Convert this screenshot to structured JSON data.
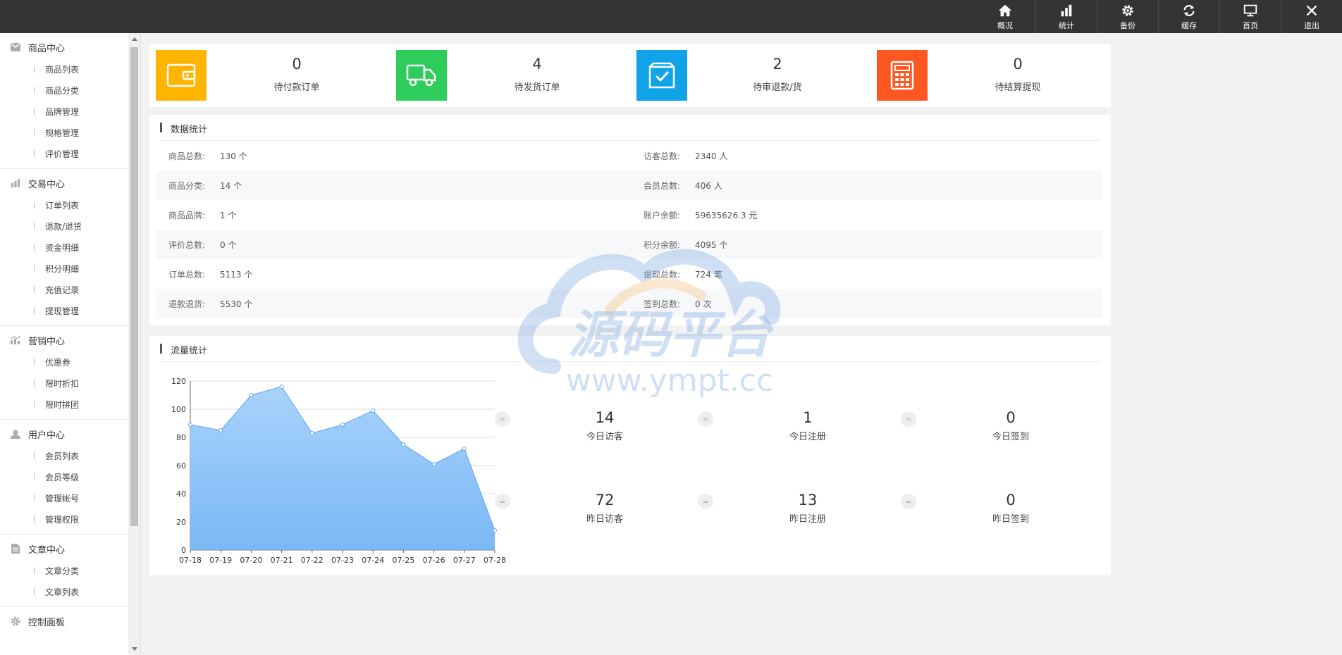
{
  "topnav": [
    {
      "label": "概况",
      "icon": "home-icon"
    },
    {
      "label": "统计",
      "icon": "bar-chart-icon"
    },
    {
      "label": "备份",
      "icon": "gear-icon"
    },
    {
      "label": "缓存",
      "icon": "refresh-icon"
    },
    {
      "label": "首页",
      "icon": "monitor-icon"
    },
    {
      "label": "退出",
      "icon": "close-icon"
    }
  ],
  "sidebar": {
    "groups": [
      {
        "title": "商品中心",
        "icon": "mail-icon",
        "items": [
          "商品列表",
          "商品分类",
          "品牌管理",
          "规格管理",
          "评价管理"
        ]
      },
      {
        "title": "交易中心",
        "icon": "bar-chart-icon",
        "items": [
          "订单列表",
          "退款/退货",
          "资金明细",
          "积分明细",
          "充值记录",
          "提现管理"
        ]
      },
      {
        "title": "营销中心",
        "icon": "marketing-chart-icon",
        "items": [
          "优惠券",
          "限时折扣",
          "限时拼团"
        ]
      },
      {
        "title": "用户中心",
        "icon": "user-icon",
        "items": [
          "会员列表",
          "会员等级",
          "管理帐号",
          "管理权限"
        ]
      },
      {
        "title": "文章中心",
        "icon": "document-icon",
        "items": [
          "文章分类",
          "文章列表"
        ]
      },
      {
        "title": "控制面板",
        "icon": "gear-icon",
        "items": []
      }
    ]
  },
  "cards": [
    {
      "value": "0",
      "label": "待付款订单",
      "color": "#ffb400",
      "icon": "wallet-icon"
    },
    {
      "value": "4",
      "label": "待发货订单",
      "color": "#2ecc5a",
      "icon": "truck-icon"
    },
    {
      "value": "2",
      "label": "待审退款/货",
      "color": "#10a3e8",
      "icon": "box-check-icon"
    },
    {
      "value": "0",
      "label": "待结算提现",
      "color": "#ff5722",
      "icon": "calculator-icon"
    }
  ],
  "data_stats": {
    "title": "数据统计",
    "rows": [
      {
        "k1": "商品总数:",
        "v1": "130 个",
        "k2": "访客总数:",
        "v2": "2340 人"
      },
      {
        "k1": "商品分类:",
        "v1": "14 个",
        "k2": "会员总数:",
        "v2": "406 人"
      },
      {
        "k1": "商品品牌:",
        "v1": "1 个",
        "k2": "账户余额:",
        "v2": "59635626.3 元"
      },
      {
        "k1": "评价总数:",
        "v1": "0 个",
        "k2": "积分余额:",
        "v2": "4095 个"
      },
      {
        "k1": "订单总数:",
        "v1": "5113 个",
        "k2": "提现总数:",
        "v2": "724 笔"
      },
      {
        "k1": "退款退货:",
        "v1": "5530 个",
        "k2": "签到总数:",
        "v2": "0 次"
      }
    ]
  },
  "traffic": {
    "title": "流量统计",
    "eq_symbol": "=",
    "stats": [
      {
        "value": "14",
        "label": "今日访客"
      },
      {
        "value": "1",
        "label": "今日注册"
      },
      {
        "value": "0",
        "label": "今日签到"
      },
      {
        "value": "72",
        "label": "昨日访客"
      },
      {
        "value": "13",
        "label": "昨日注册"
      },
      {
        "value": "0",
        "label": "昨日签到"
      }
    ]
  },
  "chart_data": {
    "type": "area",
    "categories": [
      "07-18",
      "07-19",
      "07-20",
      "07-21",
      "07-22",
      "07-23",
      "07-24",
      "07-25",
      "07-26",
      "07-27",
      "07-28"
    ],
    "values": [
      89,
      85,
      110,
      116,
      83,
      89,
      99,
      75,
      61,
      72,
      14
    ],
    "ylim": [
      0,
      120
    ],
    "yticks": [
      0,
      20,
      40,
      60,
      80,
      100,
      120
    ],
    "grid": true,
    "color": "#7ab8f5"
  },
  "watermark": {
    "title": "源码平台",
    "url": "www.ympt.cc"
  }
}
